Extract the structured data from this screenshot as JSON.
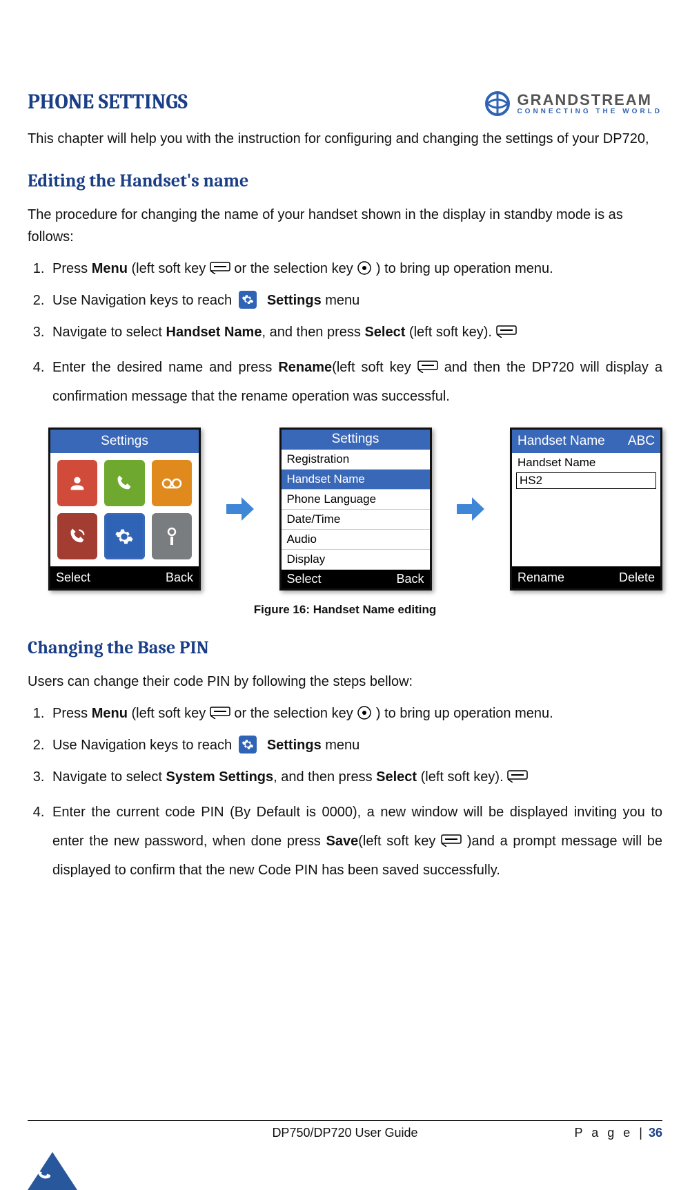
{
  "brand": {
    "name": "GRANDSTREAM",
    "tagline": "CONNECTING THE WORLD"
  },
  "h1": "PHONE SETTINGS",
  "intro": "This chapter will help you with the instruction for configuring and changing the settings of your DP720,",
  "section1": {
    "heading": "Editing the Handset's name",
    "lead": "The procedure for changing the name of your handset shown in the display in standby mode is as follows:",
    "steps": {
      "s1a": "Press ",
      "s1b": "Menu",
      "s1c": " (left soft key ",
      "s1d": " or the selection key",
      "s1e": " ) to bring up operation menu.",
      "s2a": "Use Navigation keys to reach ",
      "s2b": "Settings",
      "s2c": " menu",
      "s3a": "Navigate to select ",
      "s3b": "Handset Name",
      "s3c": ", and then press ",
      "s3d": "Select",
      "s3e": " (left soft key).",
      "s4a": "Enter the desired name and press ",
      "s4b": "Rename",
      "s4c": "(left soft key",
      "s4d": "and then the DP720 will display a confirmation message that the rename operation was successful."
    }
  },
  "screens": {
    "s1": {
      "title": "Settings",
      "left": "Select",
      "right": "Back"
    },
    "s2": {
      "title": "Settings",
      "items": [
        "Registration",
        "Handset Name",
        "Phone Language",
        "Date/Time",
        "Audio",
        "Display"
      ],
      "selected_index": 1,
      "left": "Select",
      "right": "Back"
    },
    "s3": {
      "title_left": "Handset Name",
      "title_right": "ABC",
      "label": "Handset Name",
      "value": "HS2",
      "left": "Rename",
      "right": "Delete"
    }
  },
  "figure_caption": "Figure 16: Handset Name editing",
  "section2": {
    "heading": "Changing the Base PIN",
    "lead": "Users can change their code PIN by following the steps bellow:",
    "steps": {
      "s1a": "Press ",
      "s1b": "Menu",
      "s1c": " (left soft key ",
      "s1d": " or the selection key",
      "s1e": " ) to bring up operation menu.",
      "s2a": "Use Navigation keys to reach ",
      "s2b": "Settings",
      "s2c": " menu",
      "s3a": "Navigate to select ",
      "s3b": "System Settings",
      "s3c": ", and then press ",
      "s3d": "Select",
      "s3e": " (left soft key).",
      "s4a": "Enter the current code PIN (By Default is 0000), a new window will be displayed inviting you to enter the new password, when done press ",
      "s4b": "Save",
      "s4c": "(left soft key ",
      "s4d": ")and a prompt message will be displayed to confirm that the new Code PIN has been saved successfully."
    }
  },
  "footer": {
    "center": "DP750/DP720 User Guide",
    "page_label": "P a g e |",
    "page_number": "36"
  }
}
